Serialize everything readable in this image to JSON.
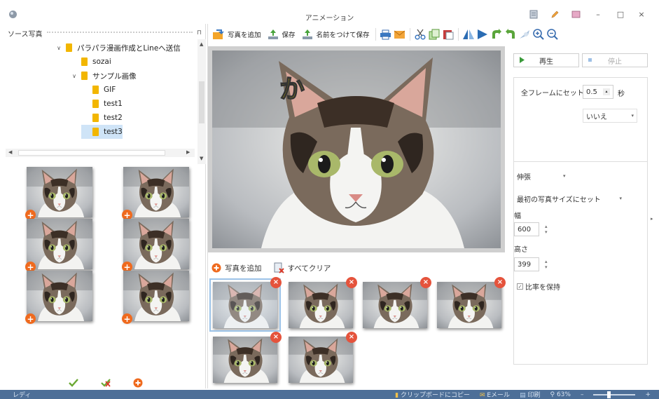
{
  "window": {
    "title": "アニメーション",
    "controls": [
      "–",
      "□",
      "×"
    ]
  },
  "left_panel": {
    "title": "ソース写真",
    "tree": [
      {
        "label": "パラパラ漫画作成とLineへ送信",
        "expanded": true,
        "indent": 0
      },
      {
        "label": "sozai",
        "expanded": false,
        "indent": 1
      },
      {
        "label": "サンプル画像",
        "expanded": true,
        "indent": 1
      },
      {
        "label": "GIF",
        "expanded": false,
        "indent": 2
      },
      {
        "label": "test1",
        "expanded": false,
        "indent": 2
      },
      {
        "label": "test2",
        "expanded": false,
        "indent": 2
      },
      {
        "label": "test3",
        "expanded": false,
        "indent": 2,
        "selected": true
      }
    ],
    "thumbnail_count": 6
  },
  "toolbar": {
    "add_photo": "写真を追加",
    "save": "保存",
    "save_as": "名前をつけて保存"
  },
  "preview": {
    "overlay_text": "か"
  },
  "frames": {
    "add_photo": "写真を追加",
    "clear_all": "すべてクリア",
    "remove_symbol": "×"
  },
  "playback": {
    "play": "再生",
    "stop": "停止"
  },
  "settings": {
    "frame_mode": "全フレームにセット",
    "duration": "0.5",
    "duration_unit": "秒",
    "loop": "いいえ"
  },
  "resize": {
    "mode": "伸張",
    "size_source": "最初の写真サイズにセット",
    "width_label": "幅",
    "width": "600",
    "height_label": "高さ",
    "height": "399",
    "keep_ratio": "比率を保持"
  },
  "statusbar": {
    "status": "レディ",
    "copy": "クリップボードにコピー",
    "email": "Eメール",
    "print": "印刷",
    "zoom": "63%"
  },
  "colors": {
    "statusbar": "#4d6f98",
    "accent_orange": "#ef6a1e",
    "remove_red": "#e5533c",
    "folder": "#f2b600"
  }
}
